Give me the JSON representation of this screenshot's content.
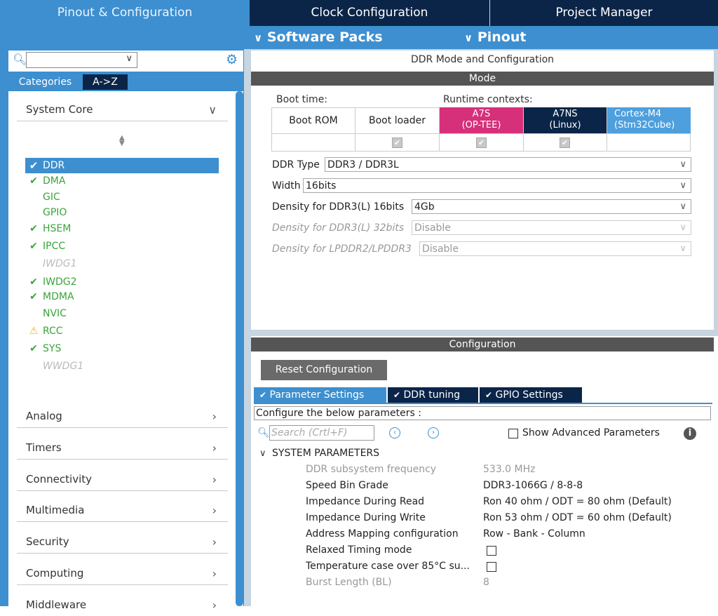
{
  "top_tabs": [
    "Pinout & Configuration",
    "Clock Configuration",
    "Project Manager"
  ],
  "sub_menu": [
    "Software Packs",
    "Pinout"
  ],
  "left": {
    "tabs": [
      "Categories",
      "A->Z"
    ],
    "system_core": {
      "label": "System Core",
      "items": [
        {
          "label": "DDR",
          "status": "selected-check"
        },
        {
          "label": "DMA",
          "status": "check"
        },
        {
          "label": "GIC",
          "status": "none"
        },
        {
          "label": "GPIO",
          "status": "none"
        },
        {
          "label": "HSEM",
          "status": "check"
        },
        {
          "label": "IPCC",
          "status": "check"
        },
        {
          "label": "IWDG1",
          "status": "disabled"
        },
        {
          "label": "IWDG2",
          "status": "check"
        },
        {
          "label": "MDMA",
          "status": "check"
        },
        {
          "label": "NVIC",
          "status": "none"
        },
        {
          "label": "RCC",
          "status": "warning"
        },
        {
          "label": "SYS",
          "status": "check"
        },
        {
          "label": "WWDG1",
          "status": "disabled"
        }
      ]
    },
    "categories": [
      "Analog",
      "Timers",
      "Connectivity",
      "Multimedia",
      "Security",
      "Computing",
      "Middleware"
    ]
  },
  "mode": {
    "panel_title": "DDR Mode and Configuration",
    "bar_label": "Mode",
    "boot_time_label": "Boot time:",
    "runtime_label": "Runtime contexts:",
    "boot_rom": "Boot ROM",
    "boot_loader": "Boot loader",
    "a7s": [
      "A7S",
      "(OP-TEE)"
    ],
    "a7ns": [
      "A7NS",
      "(Linux)"
    ],
    "cortex": [
      "Cortex-M4",
      "(Stm32Cube)"
    ],
    "ddr_type_label": "DDR Type",
    "ddr_type_value": "DDR3 / DDR3L",
    "width_label": "Width",
    "width_value": "16bits",
    "density16_label": "Density for DDR3(L) 16bits",
    "density16_value": "4Gb",
    "density32_label": "Density for DDR3(L) 32bits",
    "density32_value": "Disable",
    "densityLP_label": "Density for LPDDR2/LPDDR3",
    "densityLP_value": "Disable"
  },
  "config": {
    "bar_label": "Configuration",
    "reset_label": "Reset Configuration",
    "tabs": [
      "Parameter Settings",
      "DDR tuning",
      "GPIO Settings"
    ],
    "configure_text": "Configure the below parameters :",
    "search_placeholder": "Search (Crtl+F)",
    "show_advanced": "Show Advanced Parameters",
    "section_label": "SYSTEM PARAMETERS",
    "params": [
      {
        "name": "DDR subsystem frequency",
        "value": "533.0 MHz",
        "gray": true
      },
      {
        "name": "Speed Bin Grade",
        "value": "DDR3-1066G / 8-8-8",
        "gray": false
      },
      {
        "name": "Impedance During Read",
        "value": "Ron 40 ohm / ODT = 80 ohm (Default)",
        "gray": false
      },
      {
        "name": "Impedance During Write",
        "value": "Ron 53 ohm / ODT = 60 ohm (Default)",
        "gray": false
      },
      {
        "name": "Address Mapping configuration",
        "value": "Row - Bank - Column",
        "gray": false
      },
      {
        "name": "Relaxed Timing mode",
        "value": "",
        "gray": false
      },
      {
        "name": "Temperature case over 85°C su...",
        "value": "",
        "gray": false
      },
      {
        "name": "Burst Length (BL)",
        "value": "8",
        "gray": true
      }
    ]
  },
  "colors": {
    "accent_blue": "#3d8fcf",
    "navy": "#0b2548",
    "pink": "#d6307a",
    "check_green": "#3aa43a",
    "warning": "#f2b418"
  }
}
